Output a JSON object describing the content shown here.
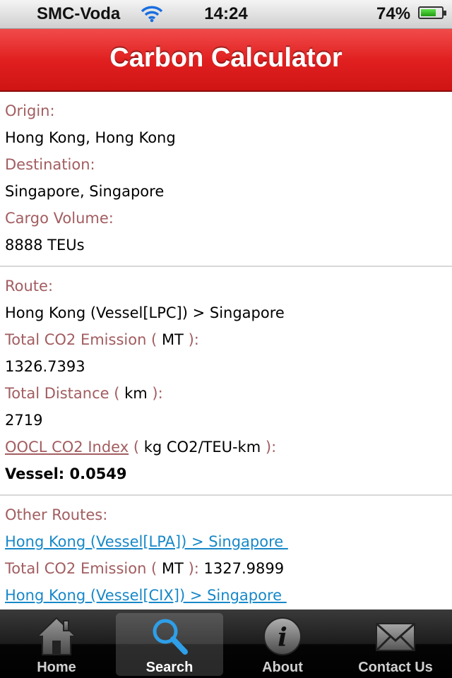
{
  "status_bar": {
    "carrier": "SMC-Voda",
    "time": "14:24",
    "battery_percent": "74%",
    "battery_level": 0.74,
    "signal_icon": "signal-bars-icon",
    "wifi_icon": "wifi-icon",
    "battery_icon": "battery-icon"
  },
  "header": {
    "title": "Carbon Calculator",
    "color": "#e01e1e"
  },
  "shipment": {
    "origin_label": "Origin:",
    "origin_value": "Hong Kong, Hong Kong",
    "destination_label": "Destination:",
    "destination_value": "Singapore, Singapore",
    "cargo_label": "Cargo Volume:",
    "cargo_value": "8888 TEUs"
  },
  "route": {
    "route_label": "Route:",
    "route_value": "Hong Kong (Vessel[LPC]) > Singapore",
    "emission_label_pre": "Total CO2 Emission (",
    "emission_unit": "MT",
    "emission_label_post": "):",
    "emission_value": "1326.7393",
    "distance_label_pre": "Total Distance (",
    "distance_unit": "km",
    "distance_label_post": "):",
    "distance_value": "2719",
    "index_link": "OOCL CO2 Index",
    "index_label_pre": "(",
    "index_unit": "kg CO2/TEU-km",
    "index_label_post": "):",
    "index_value": "Vessel: 0.0549"
  },
  "other_routes": {
    "label": "Other Routes:",
    "items": [
      {
        "link": "Hong Kong (Vessel[LPA]) > Singapore ",
        "emission_label_pre": "Total CO2 Emission (",
        "emission_unit": "MT",
        "emission_label_post": "):",
        "emission_value": "1327.9899"
      },
      {
        "link": "Hong Kong (Vessel[CIX]) > Singapore "
      }
    ]
  },
  "tab_bar": {
    "tabs": [
      {
        "label": "Home",
        "icon": "home-icon"
      },
      {
        "label": "Search",
        "icon": "search-icon",
        "active": true
      },
      {
        "label": "About",
        "icon": "info-icon"
      },
      {
        "label": "Contact Us",
        "icon": "envelope-icon"
      }
    ]
  },
  "colors": {
    "label_text": "#a25d60",
    "link_text": "#1788c8"
  }
}
